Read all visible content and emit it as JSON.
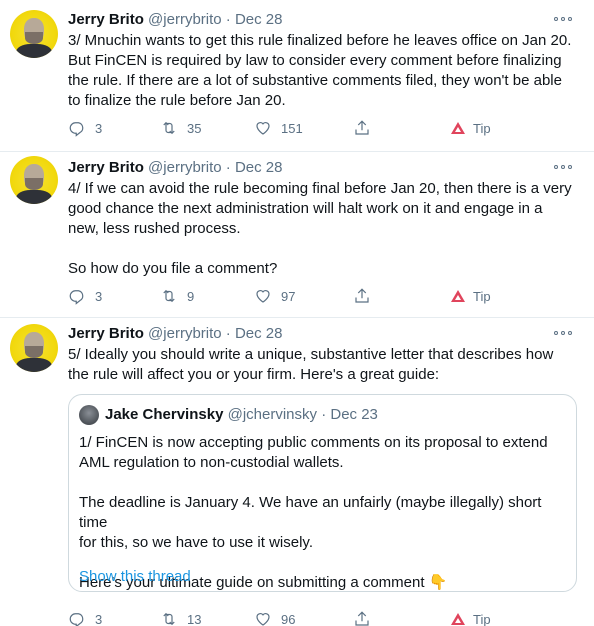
{
  "tweets": [
    {
      "author": "Jerry Brito",
      "handle": "@jerrybrito",
      "separator": "·",
      "date": "Dec 28",
      "text": "3/ Mnuchin wants to get this rule finalized before he leaves office on Jan 20.\nBut FinCEN is required by law to consider every comment before finalizing\nthe rule. If there are a lot of substantive comments filed, they won't be able\nto finalize the rule before Jan 20.",
      "replies": "3",
      "retweets": "35",
      "likes": "151",
      "tip_label": "Tip"
    },
    {
      "author": "Jerry Brito",
      "handle": "@jerrybrito",
      "separator": "·",
      "date": "Dec 28",
      "text": "4/ If we can avoid the rule becoming final before Jan 20, then there is a very\ngood chance the next administration will halt work on it and engage in a\nnew, less rushed process.\n\nSo how do you file a comment?",
      "replies": "3",
      "retweets": "9",
      "likes": "97",
      "tip_label": "Tip"
    },
    {
      "author": "Jerry Brito",
      "handle": "@jerrybrito",
      "separator": "·",
      "date": "Dec 28",
      "text": "5/ Ideally you should write a unique, substantive letter that describes how\nthe rule will affect you or your firm. Here's a great guide:",
      "replies": "3",
      "retweets": "13",
      "likes": "96",
      "tip_label": "Tip",
      "quote": {
        "author": "Jake Chervinsky",
        "handle": "@jchervinsky",
        "separator": "·",
        "date": "Dec 23",
        "text": "1/ FinCEN is now accepting public comments on its proposal to extend\nAML regulation to non-custodial wallets.\n\nThe deadline is January 4. We have an unfairly (maybe illegally) short time\nfor this, so we have to use it wisely.\n\nHere's your ultimate guide on submitting a comment 👇",
        "show_thread": "Show this thread"
      }
    }
  ],
  "icons": {
    "reply": "reply-icon",
    "retweet": "retweet-icon",
    "like": "heart-icon",
    "share": "share-icon",
    "tip": "tip-icon",
    "more": "more-options-icon"
  },
  "colors": {
    "link": "#1b95e0",
    "muted": "#5b7083",
    "tip": "#e0445c",
    "avatar_bg": "#f2d90f"
  }
}
